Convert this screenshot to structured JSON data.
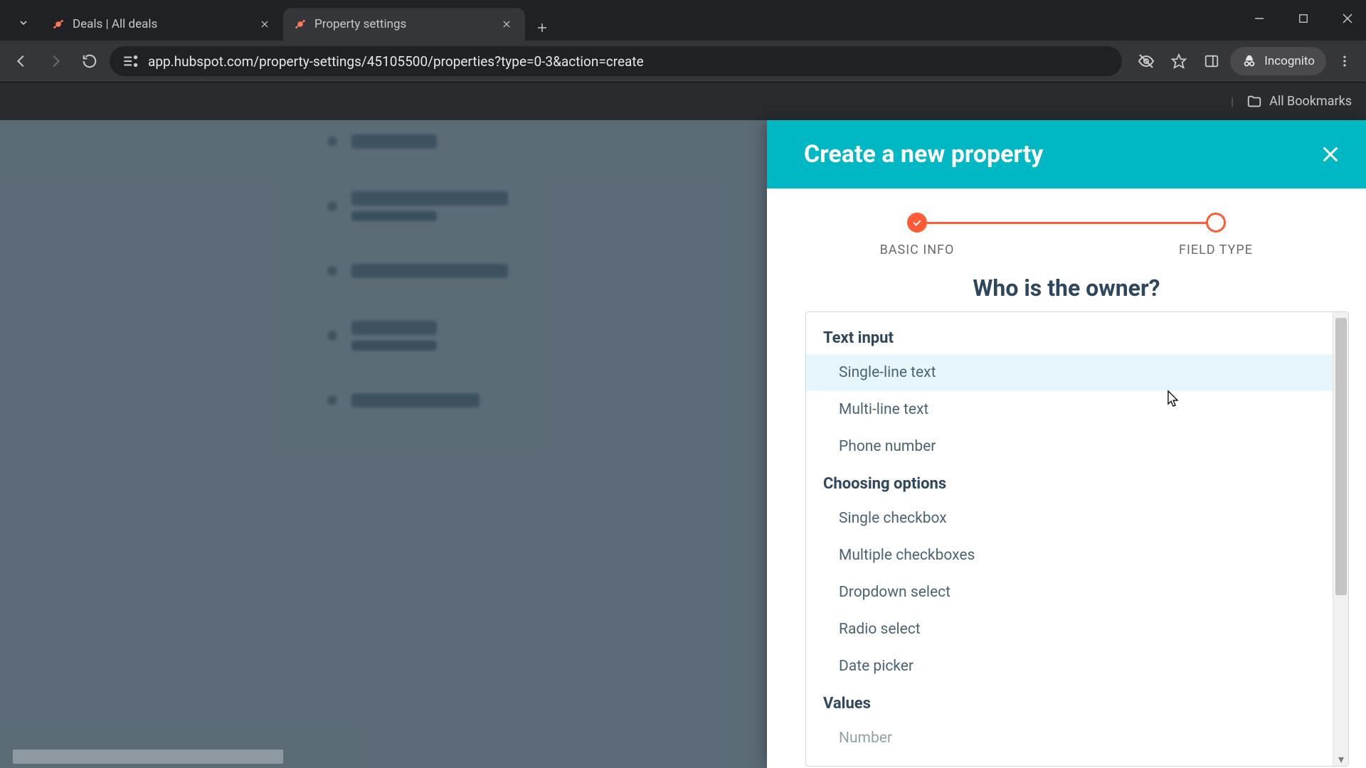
{
  "browser": {
    "tabs": [
      {
        "title": "Deals | All deals",
        "active": false
      },
      {
        "title": "Property settings",
        "active": true
      }
    ],
    "url": "app.hubspot.com/property-settings/45105500/properties?type=0-3&action=create",
    "incognito_label": "Incognito",
    "all_bookmarks": "All Bookmarks"
  },
  "panel": {
    "title": "Create a new property",
    "steps": [
      {
        "label": "BASIC INFO",
        "done": true
      },
      {
        "label": "FIELD TYPE",
        "done": false
      }
    ],
    "question": "Who is the owner?",
    "groups": [
      {
        "header": "Text input",
        "options": [
          "Single-line text",
          "Multi-line text",
          "Phone number"
        ]
      },
      {
        "header": "Choosing options",
        "options": [
          "Single checkbox",
          "Multiple checkboxes",
          "Dropdown select",
          "Radio select",
          "Date picker"
        ]
      },
      {
        "header": "Values",
        "options": [
          "Number"
        ]
      }
    ],
    "highlighted_option": "Single-line text"
  },
  "colors": {
    "accent": "#ff5c35",
    "teal": "#00b8c4"
  }
}
